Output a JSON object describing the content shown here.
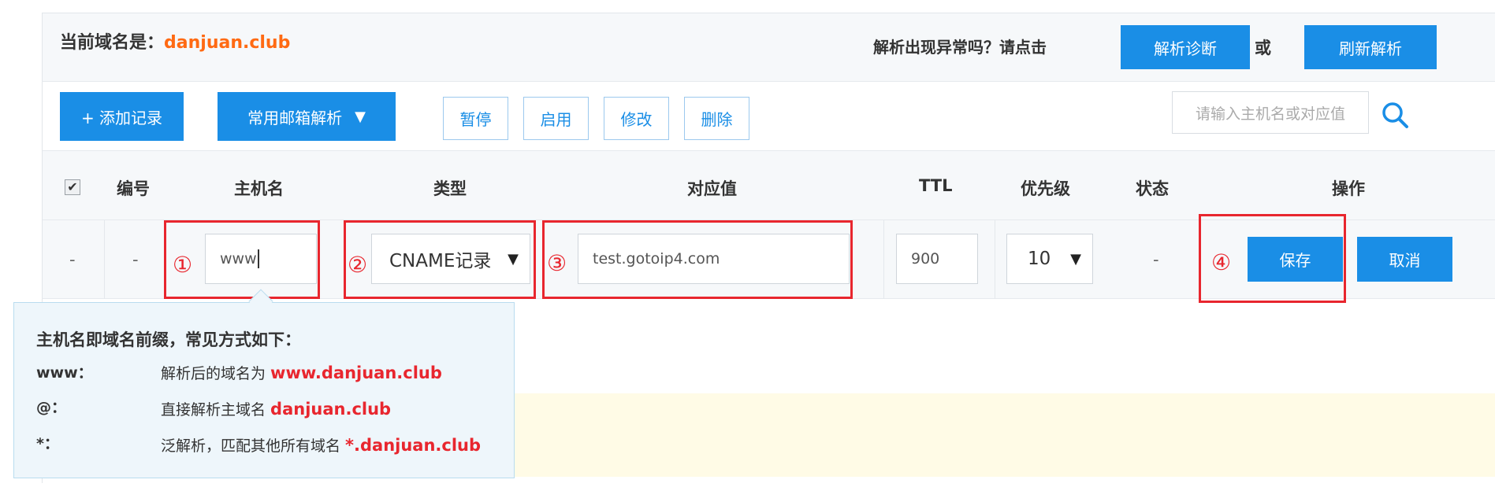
{
  "header": {
    "current_domain_label": "当前域名是：",
    "current_domain": "danjuan.club",
    "diagnose_prompt": "解析出现异常吗？请点击",
    "diagnose_button": "解析诊断",
    "or_text": "或",
    "refresh_button": "刷新解析"
  },
  "toolbar": {
    "add_record": "+ 添加记录",
    "mail_resolve": "常用邮箱解析",
    "mail_resolve_arrow": "▼",
    "pause": "暂停",
    "enable": "启用",
    "modify": "修改",
    "delete": "删除",
    "search_placeholder": "请输入主机名或对应值"
  },
  "table": {
    "columns": [
      "编号",
      "主机名",
      "类型",
      "对应值",
      "TTL",
      "优先级",
      "状态",
      "操作"
    ],
    "checkbox_mark": "✔",
    "edit_row": {
      "id": "-",
      "left_dash": "-",
      "host": "www",
      "type": "CNAME记录",
      "value": "test.gotoip4.com",
      "ttl": "900",
      "priority": "10",
      "status": "-",
      "save": "保存",
      "cancel": "取消"
    },
    "markers": [
      "①",
      "②",
      "③",
      "④"
    ]
  },
  "tooltip": {
    "title": "主机名即域名前缀，常见方式如下：",
    "items": [
      {
        "key": "www：",
        "desc": "解析后的域名为 ",
        "example": "www.danjuan.club"
      },
      {
        "key": "@：",
        "desc": "直接解析主域名 ",
        "example": "danjuan.club"
      },
      {
        "key": "*：",
        "desc": "泛解析，匹配其他所有域名 ",
        "example": "*.danjuan.club"
      }
    ]
  },
  "colors": {
    "accent_blue": "#1a8ee6",
    "domain_orange": "#ff6a13",
    "highlight_red": "#e8262e"
  }
}
